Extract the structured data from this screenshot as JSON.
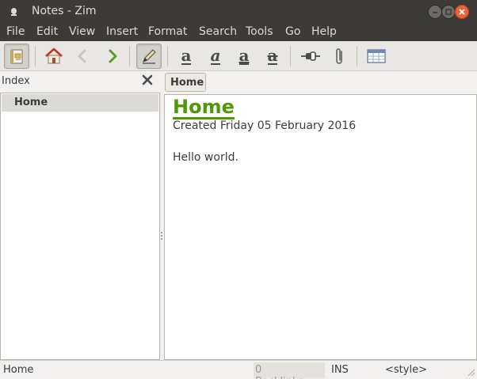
{
  "window": {
    "title": "Notes - Zim",
    "close_color": "#e9643a"
  },
  "menubar": {
    "items": [
      {
        "label": "File"
      },
      {
        "label": "Edit"
      },
      {
        "label": "View"
      },
      {
        "label": "Insert"
      },
      {
        "label": "Format"
      },
      {
        "label": "Search"
      },
      {
        "label": "Tools"
      },
      {
        "label": "Go"
      },
      {
        "label": "Help"
      }
    ]
  },
  "toolbar": {
    "buttons": [
      {
        "icon": "notebook-icon",
        "active": true
      },
      {
        "icon": "home-icon"
      },
      {
        "icon": "back-icon",
        "disabled": true
      },
      {
        "icon": "forward-icon"
      },
      {
        "icon": "edit-pencil-icon",
        "active": true
      },
      {
        "icon": "bold-icon",
        "glyph": "a"
      },
      {
        "icon": "italic-icon",
        "glyph": "a"
      },
      {
        "icon": "underline-icon",
        "glyph": "a"
      },
      {
        "icon": "strikethrough-icon",
        "glyph": "a"
      },
      {
        "icon": "insert-link-icon"
      },
      {
        "icon": "attach-file-icon"
      },
      {
        "icon": "table-icon"
      }
    ]
  },
  "index": {
    "label": "Index",
    "items": [
      {
        "label": "Home",
        "selected": true
      }
    ]
  },
  "tabs": [
    {
      "label": "Home"
    }
  ],
  "page": {
    "heading": "Home",
    "heading_color": "#4e9a06",
    "created": "Created Friday 05 February 2016",
    "body": "Hello world."
  },
  "statusbar": {
    "page": "Home",
    "backlinks": "0 Backlinks...",
    "mode": "INS",
    "style": "<style>"
  }
}
